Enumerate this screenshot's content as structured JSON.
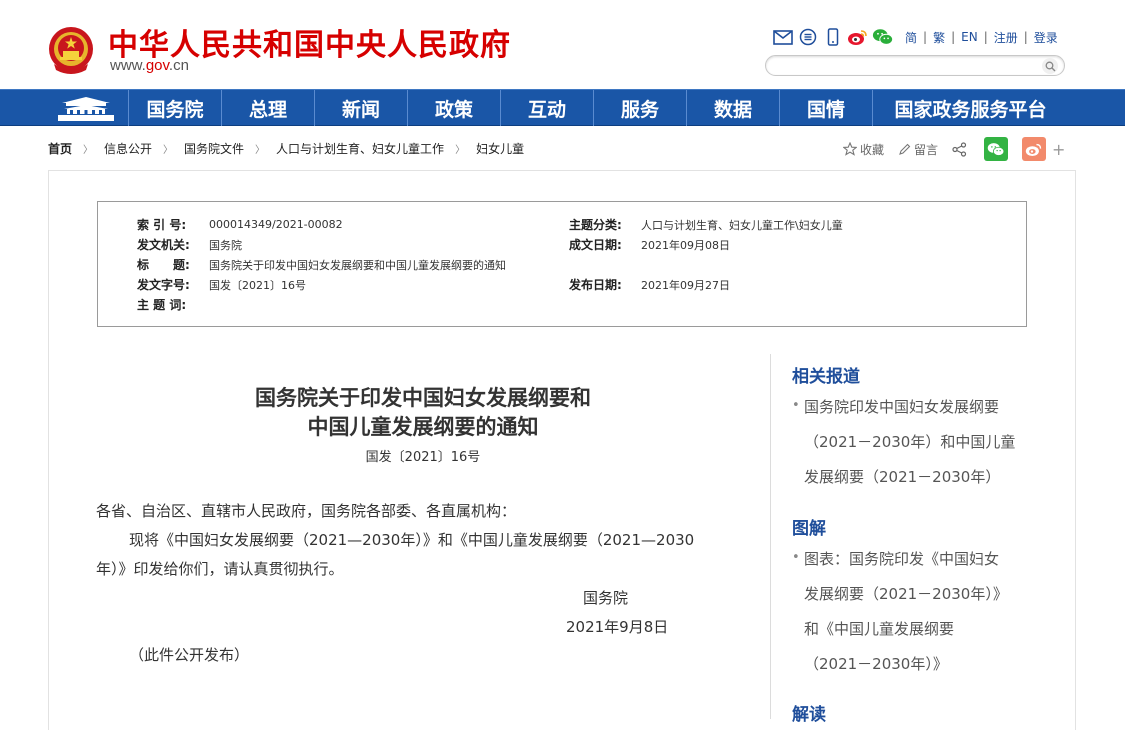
{
  "header": {
    "site_title": "中华人民共和国中央人民政府",
    "site_url_prefix": "www.",
    "site_url_brand": "gov",
    "site_url_suffix": ".cn",
    "tool_icons": [
      "mail-icon",
      "rss-icon",
      "mobile-icon",
      "weibo-icon",
      "wechat-icon"
    ],
    "lang_links": [
      "简",
      "繁",
      "EN",
      "注册",
      "登录"
    ],
    "search_placeholder": ""
  },
  "nav": {
    "items": [
      "国务院",
      "总理",
      "新闻",
      "政策",
      "互动",
      "服务",
      "数据",
      "国情",
      "国家政务服务平台"
    ]
  },
  "breadcrumb": [
    "首页",
    "信息公开",
    "国务院文件",
    "人口与计划生育、妇女儿童工作",
    "妇女儿童"
  ],
  "share": {
    "favorite": "收藏",
    "comment": "留言"
  },
  "info": {
    "index_label": "索 引 号:",
    "index_value": "000014349/2021-00082",
    "category_label": "主题分类:",
    "category_value": "人口与计划生育、妇女儿童工作\\妇女儿童",
    "issuer_label": "发文机关:",
    "issuer_value": "国务院",
    "created_label": "成文日期:",
    "created_value": "2021年09月08日",
    "title_label": "标　　题:",
    "title_value": "国务院关于印发中国妇女发展纲要和中国儿童发展纲要的通知",
    "docno_label": "发文字号:",
    "docno_value": "国发〔2021〕16号",
    "published_label": "发布日期:",
    "published_value": "2021年09月27日",
    "keywords_label": "主 题 词:"
  },
  "article": {
    "title_line1": "国务院关于印发中国妇女发展纲要和",
    "title_line2": "中国儿童发展纲要的通知",
    "doc_number": "国发〔2021〕16号",
    "greeting": "各省、自治区、直辖市人民政府，国务院各部委、各直属机构：",
    "body_line1": "现将《中国妇女发展纲要（2021—2030年）》和《中国儿童发展纲要（2021—2030",
    "body_line2": "年）》印发给你们，请认真贯彻执行。",
    "signature": "国务院",
    "date": "2021年9月8日",
    "note": "（此件公开发布）"
  },
  "sidebar": {
    "related_heading": "相关报道",
    "related_items": [
      [
        "国务院印发中国妇女发展纲要",
        "（2021－2030年）和中国儿童",
        "发展纲要（2021－2030年）"
      ]
    ],
    "graphic_heading": "图解",
    "graphic_items": [
      [
        "图表：国务院印发《中国妇女",
        "发展纲要（2021－2030年）》",
        "和《中国儿童发展纲要",
        "（2021－2030年）》"
      ]
    ],
    "interpret_heading": "解读"
  }
}
